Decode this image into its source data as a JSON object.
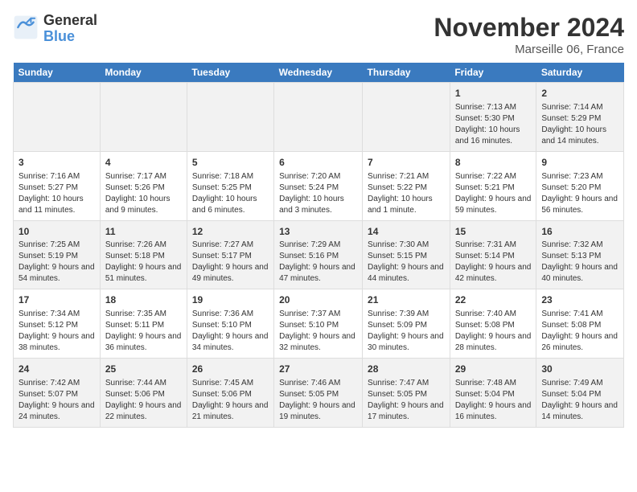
{
  "logo": {
    "general": "General",
    "blue": "Blue"
  },
  "header": {
    "month": "November 2024",
    "location": "Marseille 06, France"
  },
  "weekdays": [
    "Sunday",
    "Monday",
    "Tuesday",
    "Wednesday",
    "Thursday",
    "Friday",
    "Saturday"
  ],
  "weeks": [
    [
      {
        "day": "",
        "info": ""
      },
      {
        "day": "",
        "info": ""
      },
      {
        "day": "",
        "info": ""
      },
      {
        "day": "",
        "info": ""
      },
      {
        "day": "",
        "info": ""
      },
      {
        "day": "1",
        "info": "Sunrise: 7:13 AM\nSunset: 5:30 PM\nDaylight: 10 hours and 16 minutes."
      },
      {
        "day": "2",
        "info": "Sunrise: 7:14 AM\nSunset: 5:29 PM\nDaylight: 10 hours and 14 minutes."
      }
    ],
    [
      {
        "day": "3",
        "info": "Sunrise: 7:16 AM\nSunset: 5:27 PM\nDaylight: 10 hours and 11 minutes."
      },
      {
        "day": "4",
        "info": "Sunrise: 7:17 AM\nSunset: 5:26 PM\nDaylight: 10 hours and 9 minutes."
      },
      {
        "day": "5",
        "info": "Sunrise: 7:18 AM\nSunset: 5:25 PM\nDaylight: 10 hours and 6 minutes."
      },
      {
        "day": "6",
        "info": "Sunrise: 7:20 AM\nSunset: 5:24 PM\nDaylight: 10 hours and 3 minutes."
      },
      {
        "day": "7",
        "info": "Sunrise: 7:21 AM\nSunset: 5:22 PM\nDaylight: 10 hours and 1 minute."
      },
      {
        "day": "8",
        "info": "Sunrise: 7:22 AM\nSunset: 5:21 PM\nDaylight: 9 hours and 59 minutes."
      },
      {
        "day": "9",
        "info": "Sunrise: 7:23 AM\nSunset: 5:20 PM\nDaylight: 9 hours and 56 minutes."
      }
    ],
    [
      {
        "day": "10",
        "info": "Sunrise: 7:25 AM\nSunset: 5:19 PM\nDaylight: 9 hours and 54 minutes."
      },
      {
        "day": "11",
        "info": "Sunrise: 7:26 AM\nSunset: 5:18 PM\nDaylight: 9 hours and 51 minutes."
      },
      {
        "day": "12",
        "info": "Sunrise: 7:27 AM\nSunset: 5:17 PM\nDaylight: 9 hours and 49 minutes."
      },
      {
        "day": "13",
        "info": "Sunrise: 7:29 AM\nSunset: 5:16 PM\nDaylight: 9 hours and 47 minutes."
      },
      {
        "day": "14",
        "info": "Sunrise: 7:30 AM\nSunset: 5:15 PM\nDaylight: 9 hours and 44 minutes."
      },
      {
        "day": "15",
        "info": "Sunrise: 7:31 AM\nSunset: 5:14 PM\nDaylight: 9 hours and 42 minutes."
      },
      {
        "day": "16",
        "info": "Sunrise: 7:32 AM\nSunset: 5:13 PM\nDaylight: 9 hours and 40 minutes."
      }
    ],
    [
      {
        "day": "17",
        "info": "Sunrise: 7:34 AM\nSunset: 5:12 PM\nDaylight: 9 hours and 38 minutes."
      },
      {
        "day": "18",
        "info": "Sunrise: 7:35 AM\nSunset: 5:11 PM\nDaylight: 9 hours and 36 minutes."
      },
      {
        "day": "19",
        "info": "Sunrise: 7:36 AM\nSunset: 5:10 PM\nDaylight: 9 hours and 34 minutes."
      },
      {
        "day": "20",
        "info": "Sunrise: 7:37 AM\nSunset: 5:10 PM\nDaylight: 9 hours and 32 minutes."
      },
      {
        "day": "21",
        "info": "Sunrise: 7:39 AM\nSunset: 5:09 PM\nDaylight: 9 hours and 30 minutes."
      },
      {
        "day": "22",
        "info": "Sunrise: 7:40 AM\nSunset: 5:08 PM\nDaylight: 9 hours and 28 minutes."
      },
      {
        "day": "23",
        "info": "Sunrise: 7:41 AM\nSunset: 5:08 PM\nDaylight: 9 hours and 26 minutes."
      }
    ],
    [
      {
        "day": "24",
        "info": "Sunrise: 7:42 AM\nSunset: 5:07 PM\nDaylight: 9 hours and 24 minutes."
      },
      {
        "day": "25",
        "info": "Sunrise: 7:44 AM\nSunset: 5:06 PM\nDaylight: 9 hours and 22 minutes."
      },
      {
        "day": "26",
        "info": "Sunrise: 7:45 AM\nSunset: 5:06 PM\nDaylight: 9 hours and 21 minutes."
      },
      {
        "day": "27",
        "info": "Sunrise: 7:46 AM\nSunset: 5:05 PM\nDaylight: 9 hours and 19 minutes."
      },
      {
        "day": "28",
        "info": "Sunrise: 7:47 AM\nSunset: 5:05 PM\nDaylight: 9 hours and 17 minutes."
      },
      {
        "day": "29",
        "info": "Sunrise: 7:48 AM\nSunset: 5:04 PM\nDaylight: 9 hours and 16 minutes."
      },
      {
        "day": "30",
        "info": "Sunrise: 7:49 AM\nSunset: 5:04 PM\nDaylight: 9 hours and 14 minutes."
      }
    ]
  ]
}
